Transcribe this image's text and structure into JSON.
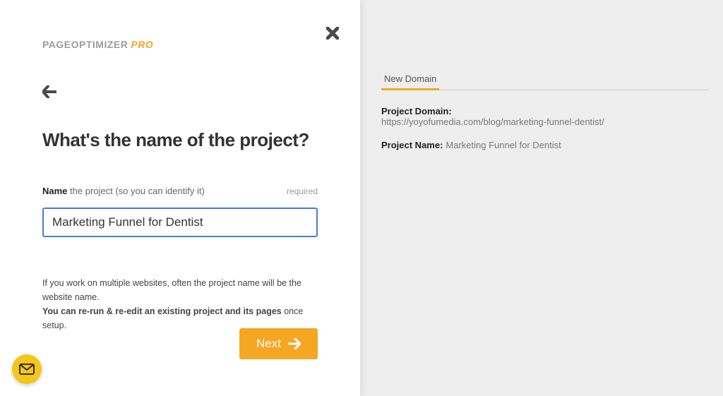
{
  "logo": {
    "main": "PAGEOPTIMIZER",
    "pro": "PRO"
  },
  "form": {
    "heading": "What's the name of the project?",
    "field_label_strong": "Name",
    "field_label_note": " the project (so you can identify it)",
    "required_text": "required",
    "input_value": "Marketing Funnel for Dentist",
    "help_line1": "If you work on multiple websites, often the project name will be the website name.",
    "help_line2_bold": "You can re-run & re-edit an existing project and its pages",
    "help_line2_rest": " once setup.",
    "next_label": "Next"
  },
  "summary": {
    "tab_label": "New Domain",
    "domain_label": "Project Domain:",
    "domain_value": "https://yoyofumedia.com/blog/marketing-funnel-dentist/",
    "name_label": "Project Name:",
    "name_value": "Marketing Funnel for Dentist"
  }
}
